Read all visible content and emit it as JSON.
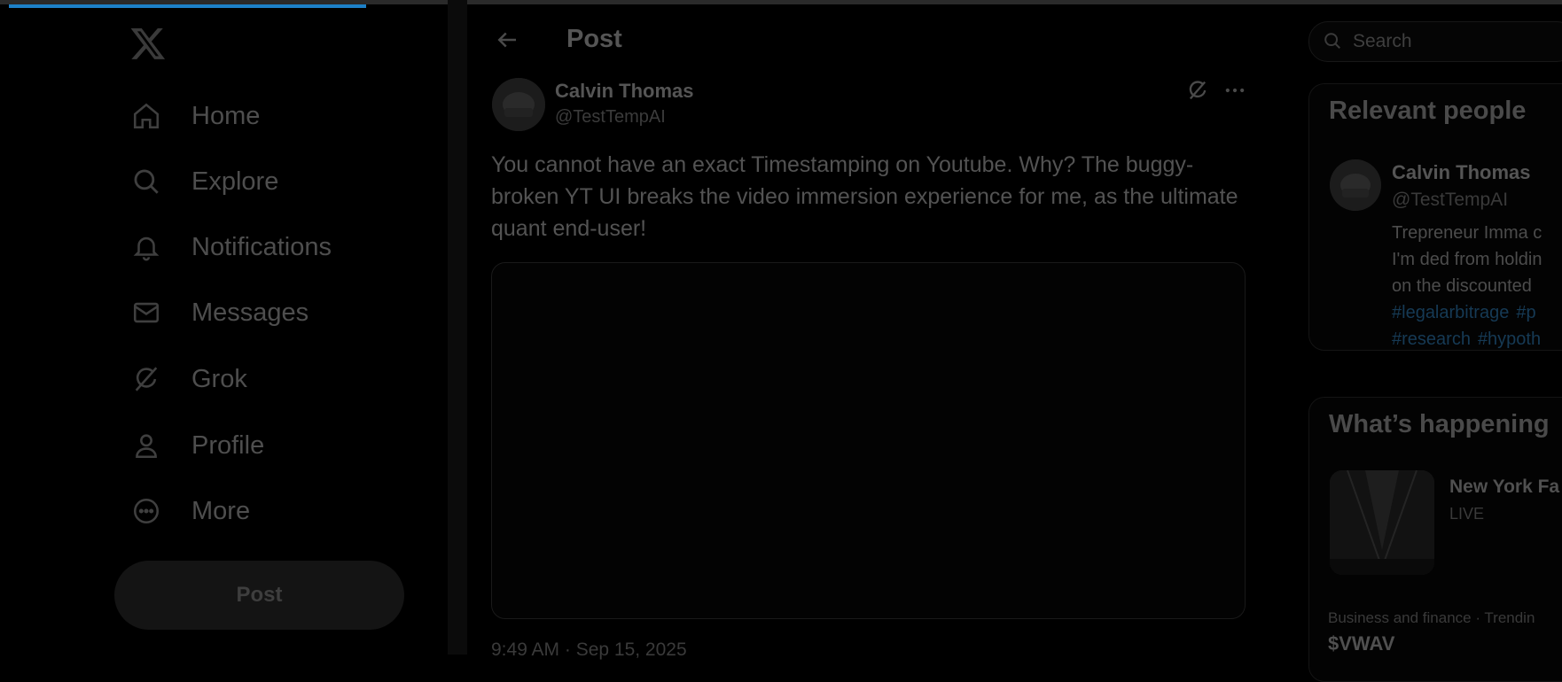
{
  "page": {
    "progress_percent": 23,
    "accent_color": "#1d80c7"
  },
  "nav": {
    "logo_icon": "x-logo-icon",
    "items": [
      {
        "label": "Home",
        "icon": "home-icon"
      },
      {
        "label": "Explore",
        "icon": "search-icon"
      },
      {
        "label": "Notifications",
        "icon": "bell-icon"
      },
      {
        "label": "Messages",
        "icon": "envelope-icon"
      },
      {
        "label": "Grok",
        "icon": "grok-icon"
      },
      {
        "label": "Profile",
        "icon": "person-icon"
      },
      {
        "label": "More",
        "icon": "more-circle-icon"
      }
    ],
    "post_button": "Post"
  },
  "main": {
    "title": "Post",
    "tweet": {
      "author_name": "Calvin Thomas",
      "author_handle": "@TestTempAI",
      "text": "You cannot have an exact Timestamping on Youtube. Why? The buggy-broken YT UI breaks the video immersion experience for me, as the ultimate quant end-user!",
      "timestamp": "9:49 AM · Sep 15, 2025"
    }
  },
  "sidebar": {
    "search_placeholder": "Search",
    "relevant_people": {
      "title": "Relevant people",
      "person": {
        "name": "Calvin Thomas",
        "handle": "@TestTempAI",
        "bio_lines": [
          "Trepreneur Imma c",
          "I'm ded from holdin",
          "on the discounted"
        ],
        "hashtag_lines": [
          [
            "#legalarbitrage",
            "#p"
          ],
          [
            "#research",
            "#hypoth"
          ]
        ]
      }
    },
    "whats_happening": {
      "title": "What’s happening",
      "event": {
        "title": "New York Fa",
        "status": "LIVE"
      },
      "trend": {
        "category": "Business and finance · Trendin",
        "name": "$VWAV"
      }
    }
  }
}
